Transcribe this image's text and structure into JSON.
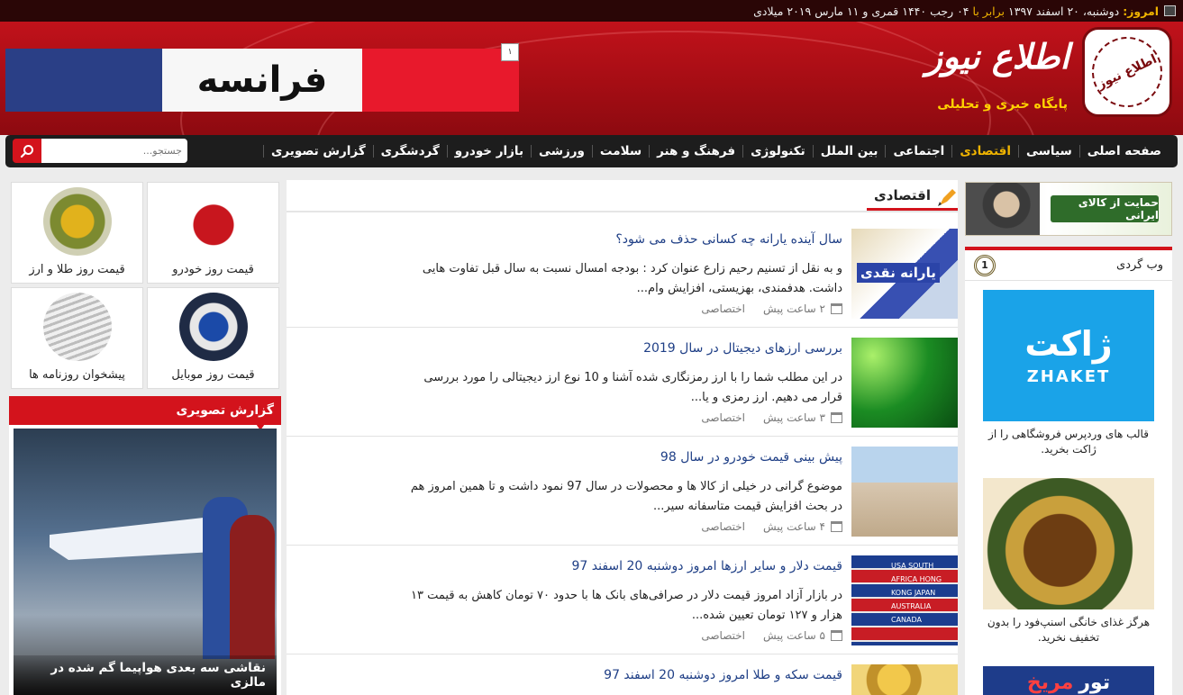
{
  "topbar": {
    "today_label": "امروز:",
    "date_text": "دوشنبه، ۲۰ اسفند ۱۳۹۷",
    "equal_label": "برابر با",
    "date_rest": "۰۴ رجب ۱۴۴۰ قمری و ۱۱ مارس ۲۰۱۹ میلادی"
  },
  "header": {
    "logo_title": "اطلاع نیوز",
    "logo_subtitle": "پایگاه خبری و تحلیلی",
    "seal_text": "اطلاع نیوز",
    "banner_text": "فرانسه",
    "banner_badge": "۱"
  },
  "nav": {
    "items": [
      "صفحه اصلی",
      "سیاسی",
      "اقتصادی",
      "اجتماعی",
      "بین الملل",
      "تکنولوژی",
      "فرهنگ و هنر",
      "سلامت",
      "ورزشی",
      "بازار خودرو",
      "گردشگری",
      "گزارش تصویری"
    ],
    "active_index": 2,
    "search_placeholder": "جستجو..."
  },
  "section": {
    "title": "اقتصادی"
  },
  "articles": [
    {
      "title": "سال آینده یارانه چه کسانی حذف می شود؟",
      "desc": "و به نقل از تسنیم رحیم زارع عنوان کرد : بودجه امسال نسبت به سال قبل تفاوت هایی داشت. هدفمندی، بهزیستی، افزایش وام...",
      "time": "۲ ساعت پیش",
      "tag": "اختصاصی",
      "thumb_text": "یارانه نقدی"
    },
    {
      "title": "بررسی ارزهای دیجیتال در سال 2019",
      "desc": "در این مطلب شما را با ارز رمزنگاری شده آشنا و 10 نوع ارز دیجیتالی را مورد بررسی قرار می دهیم. ارز رمزی و یا...",
      "time": "۳ ساعت پیش",
      "tag": "اختصاصی",
      "thumb_text": ""
    },
    {
      "title": "پیش بینی قیمت خودرو در سال 98",
      "desc": "موضوع گرانی در خیلی از کالا ها و محصولات در سال 97 نمود داشت و تا همین امروز هم در بحث افزایش قیمت متاسفانه سیر...",
      "time": "۴ ساعت پیش",
      "tag": "اختصاصی",
      "thumb_text": ""
    },
    {
      "title": "قیمت دلار و سایر ارزها امروز دوشنبه 20 اسفند 97",
      "desc": "در بازار آزاد امروز قیمت دلار در صرافی‌های بانک ها با حدود ۷۰ تومان کاهش به قیمت ۱۳ هزار و ۱۲۷ تومان تعیین شده...",
      "time": "۵ ساعت پیش",
      "tag": "اختصاصی",
      "thumb_text": "USA SOUTH AFRICA HONG KONG JAPAN AUSTRALIA CANADA"
    },
    {
      "title": "قیمت سکه و طلا امروز دوشنبه 20 اسفند 97",
      "desc": "",
      "time": "",
      "tag": "",
      "thumb_text": ""
    }
  ],
  "right": {
    "top_ad_text": "حمایت از کالای ایرانی",
    "webbox_title": "وب گردی",
    "webbox_num": "1",
    "ads": [
      {
        "caption": "قالب های وردپرس فروشگاهی را از ژاکت بخرید.",
        "logo": "ژاکت",
        "logo_en": "ZHAKET"
      },
      {
        "caption": "هرگز غذای خانگی اسنپ‌فود را بدون تخفیف نخرید."
      },
      {
        "caption": "",
        "brand1": "تور",
        "brand2": "مریخ"
      }
    ]
  },
  "left": {
    "categories": [
      {
        "label": "قیمت روز خودرو",
        "icon": "car-icon"
      },
      {
        "label": "قیمت روز طلا و ارز",
        "icon": "gold-icon"
      },
      {
        "label": "قیمت روز موبایل",
        "icon": "mobile-icon"
      },
      {
        "label": "پیشخوان روزنامه ها",
        "icon": "newspaper-icon"
      }
    ],
    "photo_report_title": "گزارش تصویری",
    "photo_caption": "نقاشی سه بعدی هواپیما گم شده در مالزی"
  },
  "colors": {
    "brand_red": "#d3131c",
    "accent_gold": "#f0b400",
    "link_blue": "#1f3f86",
    "nav_bg": "#1d1d1d"
  }
}
